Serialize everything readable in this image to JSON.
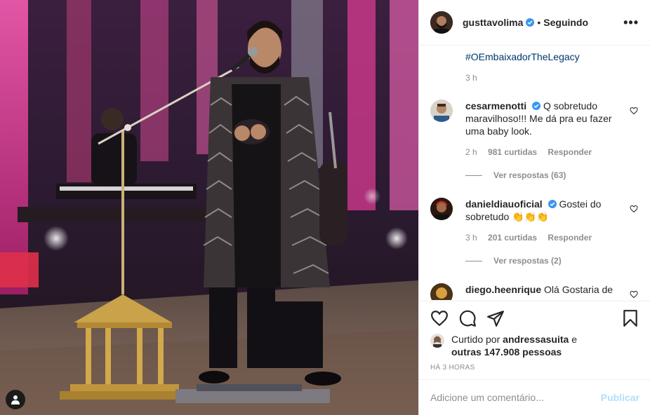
{
  "post": {
    "username": "gusttavolima",
    "separator": "•",
    "follow_status": "Seguindo",
    "more_icon": "•••"
  },
  "caption": {
    "hashtag": "#OEmbaixadorTheLegacy",
    "time": "3 h"
  },
  "comments": [
    {
      "username": "cesarmenotti",
      "text": "Q sobretudo maravilhoso!!! Me dá pra eu fazer uma baby look.",
      "time": "2 h",
      "likes": "981 curtidas",
      "reply": "Responder",
      "view_replies": "Ver respostas (63)"
    },
    {
      "username": "danieldiauoficial",
      "text": "Gostei do sobretudo 👏👏👏",
      "time": "3 h",
      "likes": "201 curtidas",
      "reply": "Responder",
      "view_replies": "Ver respostas (2)"
    },
    {
      "username": "diego.heenrique",
      "text": "Olá Gostaria de"
    }
  ],
  "likes_summary": {
    "prefix": "Curtido por",
    "user": "andressasuita",
    "conjunction": "e",
    "others": "outras 147.908 pessoas"
  },
  "posted_ago": "HÁ 3 HORAS",
  "comment_box": {
    "placeholder": "Adicione um comentário...",
    "publish": "Publicar"
  },
  "colors": {
    "link": "#00376b",
    "muted": "#8e8e8e",
    "publish_disabled": "#b2dffc",
    "verified": "#3897f0"
  },
  "icons": [
    "heart-icon",
    "comment-icon",
    "share-icon",
    "bookmark-icon",
    "user-tag-icon",
    "verified-icon",
    "more-icon"
  ]
}
